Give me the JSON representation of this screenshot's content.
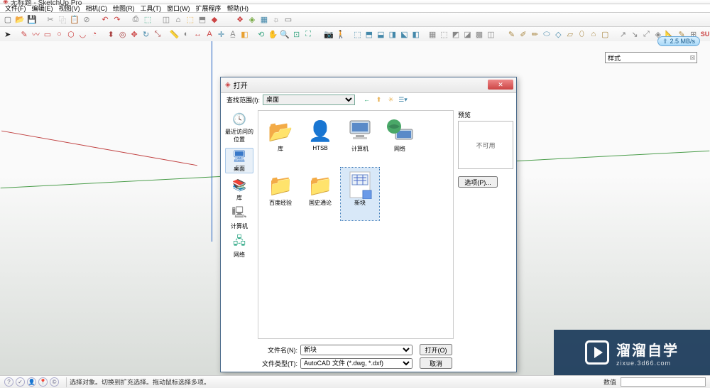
{
  "window": {
    "title": "无标题 - SketchUp Pro"
  },
  "menu": {
    "items": [
      "文件(F)",
      "编辑(E)",
      "视图(V)",
      "相机(C)",
      "绘图(R)",
      "工具(T)",
      "窗口(W)",
      "扩展程序",
      "帮助(H)"
    ]
  },
  "speed_badge": "2.5 MB/s",
  "styles_panel": {
    "label": "样式"
  },
  "dialog": {
    "title": "打开",
    "lookin_label": "查找范围(I):",
    "lookin_value": "桌面",
    "places": [
      {
        "label": "最近访问的位置",
        "icon": "recent"
      },
      {
        "label": "桌面",
        "icon": "desktop",
        "selected": true
      },
      {
        "label": "库",
        "icon": "libraries"
      },
      {
        "label": "计算机",
        "icon": "computer"
      },
      {
        "label": "网络",
        "icon": "network"
      }
    ],
    "files": [
      {
        "label": "库",
        "type": "libraries"
      },
      {
        "label": "HTSB",
        "type": "user"
      },
      {
        "label": "计算机",
        "type": "computer"
      },
      {
        "label": "网络",
        "type": "network"
      },
      {
        "label": "百度经验",
        "type": "folder"
      },
      {
        "label": "国史通论",
        "type": "folder"
      },
      {
        "label": "新块",
        "type": "file",
        "selected": true
      }
    ],
    "preview_label": "预览",
    "preview_text": "不可用",
    "options_btn": "选项(P)...",
    "filename_label": "文件名(N):",
    "filename_value": "新块",
    "filetype_label": "文件类型(T):",
    "filetype_value": "AutoCAD 文件 (*.dwg, *.dxf)",
    "open_btn": "打开(O)",
    "cancel_btn": "取消"
  },
  "status": {
    "hint": "选择对象。切换到扩充选择。拖动鼠标选择多项。",
    "measure_label": "数值"
  },
  "watermark": {
    "big": "溜溜自学",
    "small": "zixue.3d66.com"
  }
}
